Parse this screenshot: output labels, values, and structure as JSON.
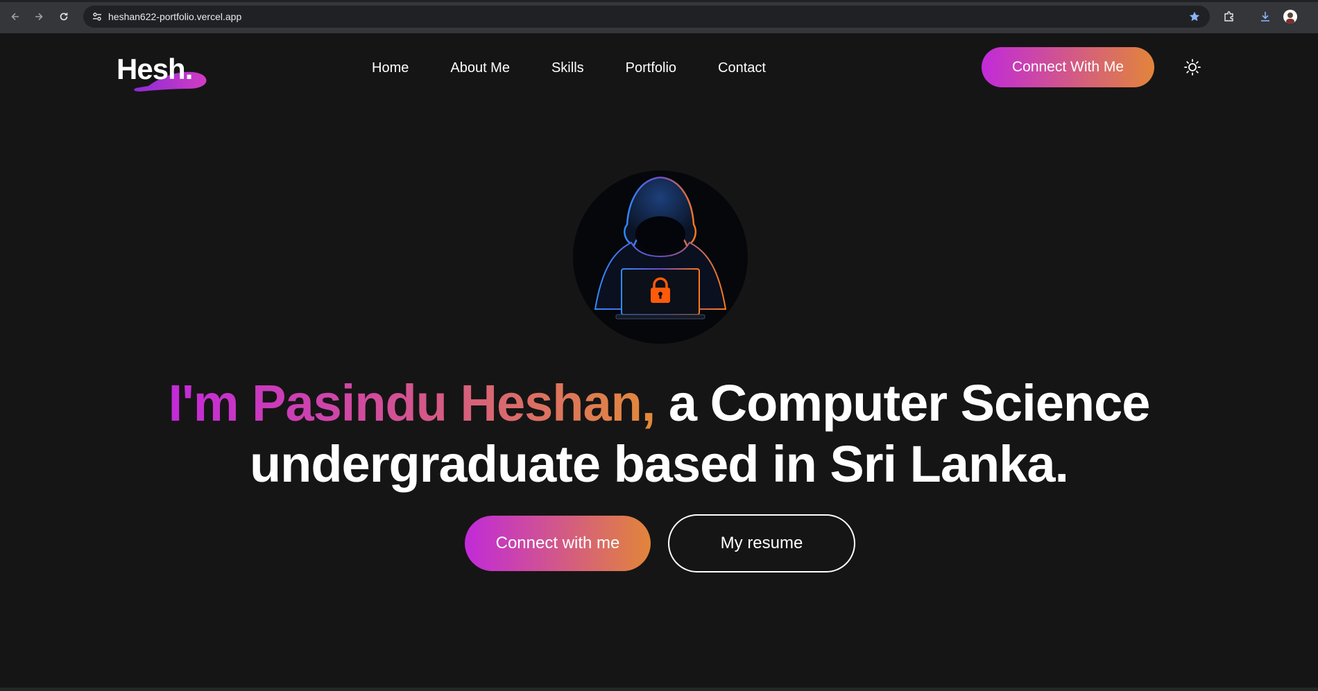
{
  "browser": {
    "url": "heshan622-portfolio.vercel.app",
    "icons": [
      "back-icon",
      "forward-icon",
      "reload-icon",
      "site-info-icon",
      "bookmark-star-icon",
      "extensions-icon",
      "download-icon",
      "profile-avatar"
    ],
    "star_color": "#8ab4f8"
  },
  "header": {
    "logo": "Hesh.",
    "nav": [
      "Home",
      "About Me",
      "Skills",
      "Portfolio",
      "Contact"
    ],
    "cta": "Connect With Me",
    "theme_toggle_icon": "sun-icon"
  },
  "hero": {
    "image_icon": "hooded-hacker-laptop-lock",
    "headline_highlight": "I'm Pasindu Heshan,",
    "headline_line1_rest": " a Computer Science",
    "headline_line2": "undergraduate based in Sri Lanka.",
    "primary_button": "Connect with me",
    "secondary_button": "My resume"
  },
  "colors": {
    "background": "#161515",
    "gradient_start": "#c12ad9",
    "gradient_end": "#e2853a",
    "text": "#ffffff"
  }
}
